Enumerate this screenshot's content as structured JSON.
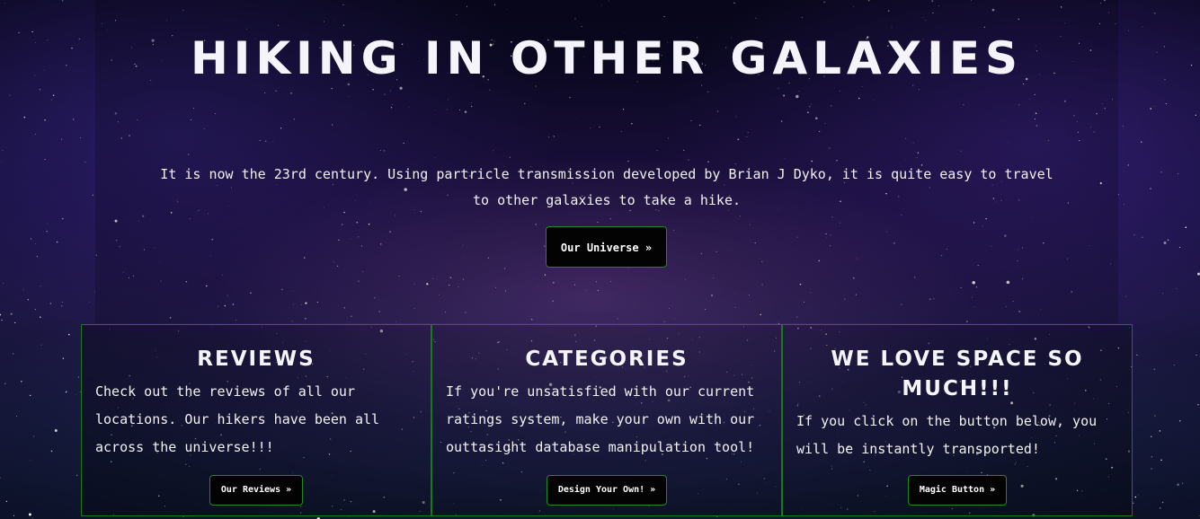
{
  "hero": {
    "title": "Hiking in other galaxies",
    "lead": "It is now the 23rd century. Using partricle transmission developed by Brian J Dyko, it is quite easy to travel to other galaxies to take a hike.",
    "button_label": "Our Universe »"
  },
  "cards": [
    {
      "title": "Reviews",
      "text": "Check out the reviews of all our locations. Our hikers have been all across the universe!!!",
      "button_label": "Our Reviews »"
    },
    {
      "title": "Categories",
      "text": "If you're unsatisfied with our current ratings system, make your own with our outtasight database manipulation tool!",
      "button_label": "Design Your Own! »"
    },
    {
      "title": "We love space so much!!!",
      "text": "If you click on the button below, you will be instantly transported!",
      "button_label": "Magic Button »"
    }
  ],
  "colors": {
    "button_border": "#1f8a1f",
    "card_border": "#1a7a1a",
    "button_bg": "#030303",
    "text": "#f2f2f2"
  }
}
